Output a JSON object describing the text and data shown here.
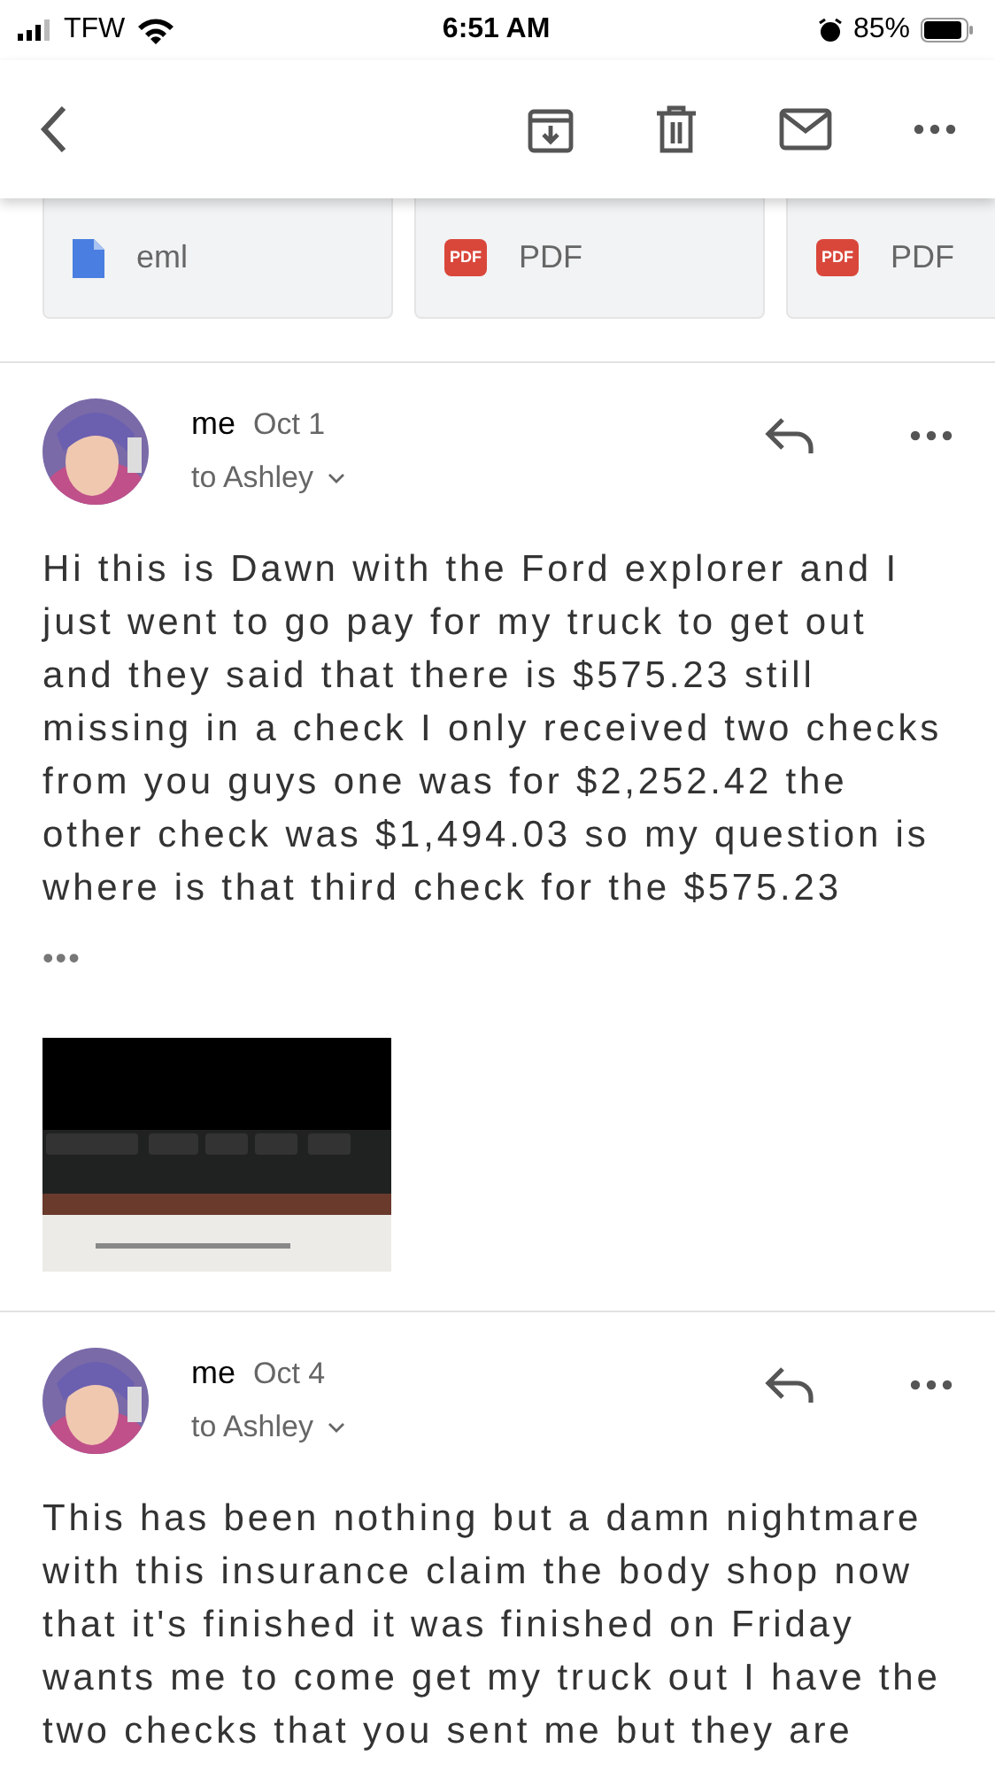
{
  "status_bar": {
    "carrier": "TFW",
    "time": "6:51 AM",
    "battery": "85%"
  },
  "attachments": [
    {
      "kind": "eml",
      "type_label": "eml"
    },
    {
      "kind": "pdf",
      "type_label": "PDF",
      "badge": "PDF"
    },
    {
      "kind": "pdf",
      "type_label": "PDF",
      "badge": "PDF"
    }
  ],
  "messages": [
    {
      "sender": "me",
      "date": "Oct 1",
      "recipient": "to Ashley",
      "body": "Hi this is Dawn with the Ford explorer and I just went to go pay for my truck to get out and they said that there is $575.23 still missing in a check I only received two checks from you guys one was for $2,252.42 the other check was $1,494.03 so my question is where is that third check for the $575.23",
      "trimmed": "•••"
    },
    {
      "sender": "me",
      "date": "Oct 4",
      "recipient": "to Ashley",
      "body": "This has been nothing but a damn nightmare with this insurance claim the body shop now that it's finished it was finished on Friday wants me to come get my truck out I have the two checks that you sent me but they are"
    }
  ]
}
